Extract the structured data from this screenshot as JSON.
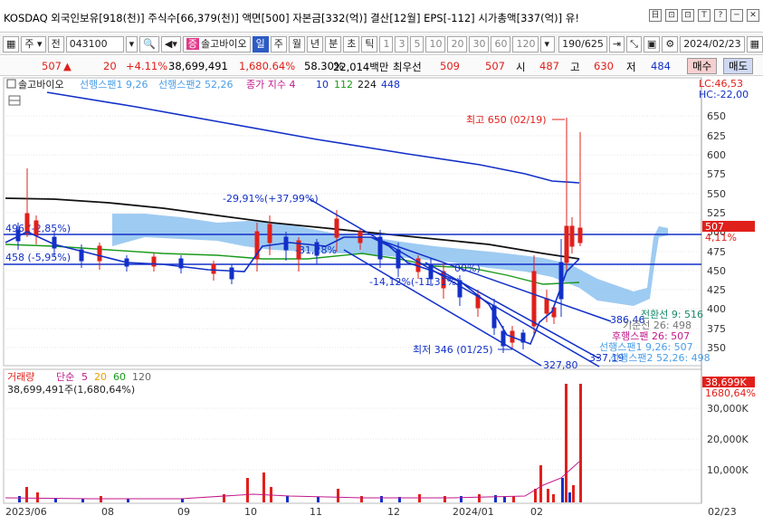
{
  "titlebar": {
    "info": "KOSDAQ 외국인보유[918(천)] 주식수[66,379(천)] 액면[500] 자본금[332(억)] 결산[12월] EPS[-112] 시가총액[337(억)] 유!",
    "buttons": [
      "日",
      "⊡",
      "⊡",
      "T",
      "?",
      "─",
      "✕"
    ]
  },
  "toolbar": {
    "market": "주",
    "mode": "전",
    "code": "043100",
    "name": "솔고바이오",
    "period_tabs": [
      "일",
      "주",
      "월",
      "년",
      "분",
      "초",
      "틱"
    ],
    "selected_period": "일",
    "intervals": [
      "1",
      "3",
      "5",
      "10",
      "20",
      "30",
      "60",
      "120"
    ],
    "count": "190/625",
    "date": "2024/02/23"
  },
  "quote": {
    "price": "507",
    "arrow": "▲",
    "change": "20",
    "change_pct": "+4.11%",
    "volume": "38,699,491",
    "volume_ratio": "1,680.64%",
    "rate": "58.30%",
    "amount": "22,014백만",
    "best_ask_label": "최우선",
    "best_ask": "509",
    "best_bid": "507",
    "open_label": "시",
    "open": "487",
    "high_label": "고",
    "high": "630",
    "low_label": "저",
    "low": "484",
    "buy_label": "매수",
    "sell_label": "매도"
  },
  "legend": {
    "name": "솔고바이오",
    "span1": "선행스팬1 9,26",
    "span2": "선행스팬2 52,26",
    "ma_label": "종가 지수 4",
    "ma_periods": [
      "10",
      "112",
      "224",
      "448"
    ],
    "lc": "LC:46,53",
    "hc": "HC:-22,00"
  },
  "annotations": {
    "high": "최고 650 (02/19)",
    "low": "최저 346 (01/25)",
    "pct1": "-29,91%(+37,99%)",
    "pct2": "-14,12%(-11,31%)",
    "pct3": "-31,28%",
    "pct4": "00%)",
    "hline1": "496 (-2,85%)",
    "hline2": "458 (-5,95%)",
    "t1": "386,46",
    "t2": "337,19",
    "t3": "327,80",
    "ich1": "전환선 9: 516",
    "ich2": "기준선 26: 498",
    "ich3": "후행스팬 26: 507",
    "ich4": "선행스팬1 9,26: 507",
    "ich5": "선행스팬2 52,26: 498",
    "price_tag": "507",
    "price_pct": "4,11%"
  },
  "volume_panel": {
    "label": "거래량",
    "type": "단순",
    "periods": [
      "5",
      "20",
      "60",
      "120"
    ],
    "value": "38,699,491주(1,680,64%)",
    "tag": "38,699K",
    "tag_pct": "1680,64%"
  },
  "price_axis": [
    "650",
    "625",
    "600",
    "575",
    "550",
    "525",
    "500",
    "475",
    "450",
    "425",
    "400",
    "375",
    "350"
  ],
  "volume_axis": [
    "30,000K",
    "20,000K",
    "10,000K"
  ],
  "x_axis": [
    "2023/06",
    "08",
    "09",
    "10",
    "11",
    "12",
    "2024/01",
    "02",
    "02/23"
  ],
  "colors": {
    "up": "#e0201b",
    "down": "#1230c8",
    "ma10": "#1230c8",
    "ma112": "#1a9a1a",
    "ma224": "#111111",
    "cloud": "#7eb9ee",
    "buy_bg": "#f6d0d0",
    "sell_bg": "#cfd9f4"
  }
}
